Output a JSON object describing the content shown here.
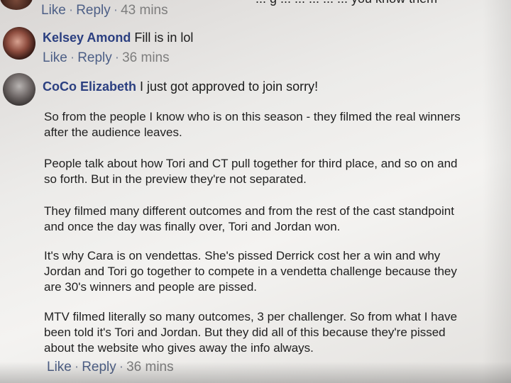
{
  "previous_comment": {
    "text_fragment": "... g ... ... ... ... ... you know them",
    "actions": {
      "like": "Like",
      "reply": "Reply",
      "time": "43 mins"
    }
  },
  "comments": [
    {
      "author": "Kelsey Amond",
      "text": "Fill is in lol",
      "actions": {
        "like": "Like",
        "reply": "Reply",
        "time": "36 mins"
      }
    },
    {
      "author": "CoCo Elizabeth",
      "text": "I just got approved to join sorry!",
      "paragraphs": [
        "So from the people I know who is on this season - they filmed the real winners after the audience leaves.",
        "People talk about how Tori and CT pull together for third place, and so on and so forth. But in the preview they're not separated.",
        "They filmed many different outcomes and from the rest of the cast standpoint and once the day was finally over, Tori and Jordan won.",
        "It's why Cara is on vendettas. She's pissed Derrick cost her a win and why Jordan and Tori go together to compete in a vendetta challenge because they are 30's winners and people are pissed.",
        "MTV filmed literally so many outcomes, 3 per challenger. So from what I have been told it's Tori and Jordan. But they did all of this because they're pissed about the website who gives away the info always."
      ],
      "actions": {
        "like": "Like",
        "reply": "Reply",
        "time": "36 mins"
      }
    }
  ],
  "separator": "·",
  "colors": {
    "link": "#4d5f86",
    "author": "#2b3f80",
    "text": "#1f1f1f",
    "muted": "#7d7d7d"
  }
}
